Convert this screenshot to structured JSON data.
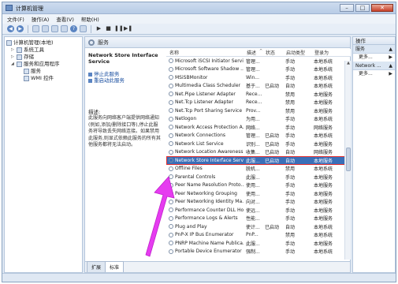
{
  "window": {
    "title": "计算机管理",
    "buttons": {
      "minimize": "–",
      "maximize": "□",
      "close": "✕"
    }
  },
  "menu": [
    "文件(F)",
    "操作(A)",
    "查看(V)",
    "帮助(H)"
  ],
  "tree": {
    "root": "计算机管理(本地)",
    "items": [
      {
        "label": "系统工具",
        "level": 1
      },
      {
        "label": "存储",
        "level": 1
      },
      {
        "label": "服务和应用程序",
        "level": 1
      },
      {
        "label": "服务",
        "level": 2
      },
      {
        "label": "WMI 控件",
        "level": 2
      }
    ]
  },
  "center": {
    "title": "服务",
    "desc": {
      "service_title": "Network Store Interface Service",
      "links": [
        "停止此服务",
        "重启动此服务"
      ],
      "label": "描述:",
      "text": "此服务向网络客户端提供网络通知(例如,添加/删除接口等),停止此服务将导致丢失网络连接。如果禁用此服务,则显式依赖此服务的所有其他服务都将无法启动。"
    },
    "columns": [
      "名称",
      "描述",
      "状态",
      "启动类型",
      "登录为"
    ],
    "rows": [
      {
        "name": "Microsoft iSCSI Initiator Servi...",
        "desc": "管理...",
        "status": "",
        "start": "手动",
        "logon": "本地系统"
      },
      {
        "name": "Microsoft Software Shadow ...",
        "desc": "管理...",
        "status": "",
        "start": "手动",
        "logon": "本地系统"
      },
      {
        "name": "MSiSBMonitor",
        "desc": "Win...",
        "status": "",
        "start": "手动",
        "logon": "本地系统"
      },
      {
        "name": "Multimedia Class Scheduler",
        "desc": "基于...",
        "status": "已启动",
        "start": "自动",
        "logon": "本地系统"
      },
      {
        "name": "Net.Pipe Listener Adapter",
        "desc": "Rece...",
        "status": "",
        "start": "禁用",
        "logon": "本地服务"
      },
      {
        "name": "Net.Tcp Listener Adapter",
        "desc": "Rece...",
        "status": "",
        "start": "禁用",
        "logon": "本地服务"
      },
      {
        "name": "Net.Tcp Port Sharing Service",
        "desc": "Prov...",
        "status": "",
        "start": "禁用",
        "logon": "本地服务"
      },
      {
        "name": "Netlogon",
        "desc": "为用...",
        "status": "",
        "start": "手动",
        "logon": "本地系统"
      },
      {
        "name": "Network Access Protection A...",
        "desc": "网络...",
        "status": "",
        "start": "手动",
        "logon": "网络服务"
      },
      {
        "name": "Network Connections",
        "desc": "管理...",
        "status": "已启动",
        "start": "手动",
        "logon": "本地系统"
      },
      {
        "name": "Network List Service",
        "desc": "识别...",
        "status": "已启动",
        "start": "手动",
        "logon": "本地服务"
      },
      {
        "name": "Network Location Awareness",
        "desc": "收集...",
        "status": "已启动",
        "start": "自动",
        "logon": "网络服务"
      },
      {
        "name": "Network Store Interface Serv...",
        "desc": "此服...",
        "status": "已启动",
        "start": "自动",
        "logon": "本地服务",
        "selected": true
      },
      {
        "name": "Offline Files",
        "desc": "脱机...",
        "status": "",
        "start": "禁用",
        "logon": "本地系统"
      },
      {
        "name": "Parental Controls",
        "desc": "此服...",
        "status": "",
        "start": "手动",
        "logon": "本地服务"
      },
      {
        "name": "Peer Name Resolution Proto...",
        "desc": "使用...",
        "status": "",
        "start": "手动",
        "logon": "本地服务"
      },
      {
        "name": "Peer Networking Grouping",
        "desc": "使用...",
        "status": "",
        "start": "手动",
        "logon": "本地服务"
      },
      {
        "name": "Peer Networking Identity Ma...",
        "desc": "向对...",
        "status": "",
        "start": "手动",
        "logon": "本地服务"
      },
      {
        "name": "Performance Counter DLL Host",
        "desc": "使远...",
        "status": "",
        "start": "手动",
        "logon": "本地服务"
      },
      {
        "name": "Performance Logs & Alerts",
        "desc": "性能...",
        "status": "",
        "start": "手动",
        "logon": "本地服务"
      },
      {
        "name": "Plug and Play",
        "desc": "使计...",
        "status": "已启动",
        "start": "自动",
        "logon": "本地系统"
      },
      {
        "name": "PnP-X IP Bus Enumerator",
        "desc": "PnP...",
        "status": "",
        "start": "禁用",
        "logon": "本地系统"
      },
      {
        "name": "PNRP Machine Name Publica...",
        "desc": "此服...",
        "status": "",
        "start": "手动",
        "logon": "本地服务"
      },
      {
        "name": "Portable Device Enumerator ...",
        "desc": "强制...",
        "status": "",
        "start": "手动",
        "logon": "本地系统"
      }
    ],
    "tabs": [
      "扩展",
      "标准"
    ]
  },
  "actions": {
    "header": "操作",
    "sections": [
      {
        "title": "服务",
        "items": [
          "更多..."
        ]
      },
      {
        "title": "Network ...",
        "items": [
          "更多..."
        ]
      }
    ]
  },
  "colors": {
    "selection": "#3a6fb8",
    "highlight_border": "#e32d2d",
    "arrow": "#e63cf0"
  }
}
